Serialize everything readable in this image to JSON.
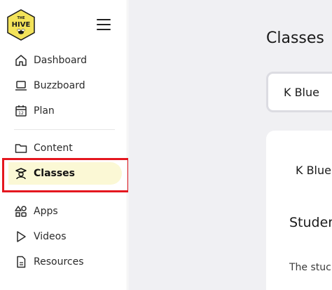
{
  "brand": {
    "logo_text_top": "THE",
    "logo_text_main": "HIVE",
    "logo_color": "#f3e35a"
  },
  "sidebar": {
    "items": [
      {
        "label": "Dashboard",
        "icon": "home-icon"
      },
      {
        "label": "Buzzboard",
        "icon": "laptop-icon"
      },
      {
        "label": "Plan",
        "icon": "calendar-icon"
      },
      {
        "label": "Content",
        "icon": "folder-icon"
      },
      {
        "label": "Classes",
        "icon": "student-icon",
        "active": true
      },
      {
        "label": "Apps",
        "icon": "apps-icon"
      },
      {
        "label": "Videos",
        "icon": "play-icon"
      },
      {
        "label": "Resources",
        "icon": "document-icon"
      }
    ]
  },
  "main": {
    "title": "Classes",
    "class_select": "K Blue",
    "card": {
      "class_name": "K Blue",
      "heading": "Studer",
      "text": "The stuc"
    }
  },
  "colors": {
    "active_bg": "#fbf8d5",
    "highlight": "#e4171f",
    "main_bg": "#f0f0f3"
  }
}
